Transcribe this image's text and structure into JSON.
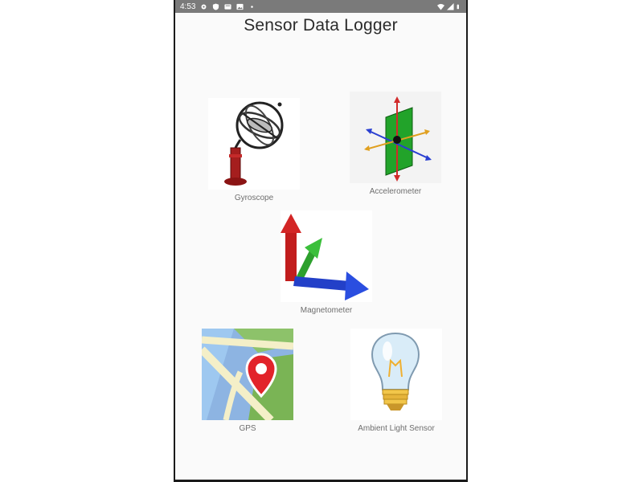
{
  "status_bar": {
    "time": "4:53",
    "icons": [
      "settings-icon",
      "shield-icon",
      "card-icon",
      "photo-icon",
      "dot-icon"
    ],
    "right_icons": [
      "wifi-icon",
      "signal-icon",
      "battery-icon"
    ]
  },
  "app": {
    "title": "Sensor Data Logger"
  },
  "sensors": {
    "gyroscope": {
      "label": "Gyroscope",
      "icon": "gyroscope-icon"
    },
    "accelerometer": {
      "label": "Accelerometer",
      "icon": "accelerometer-icon"
    },
    "magnetometer": {
      "label": "Magnetometer",
      "icon": "magnetometer-icon"
    },
    "gps": {
      "label": "GPS",
      "icon": "map-pin-icon"
    },
    "ambient_light": {
      "label": "Ambient Light Sensor",
      "icon": "light-bulb-icon"
    }
  }
}
